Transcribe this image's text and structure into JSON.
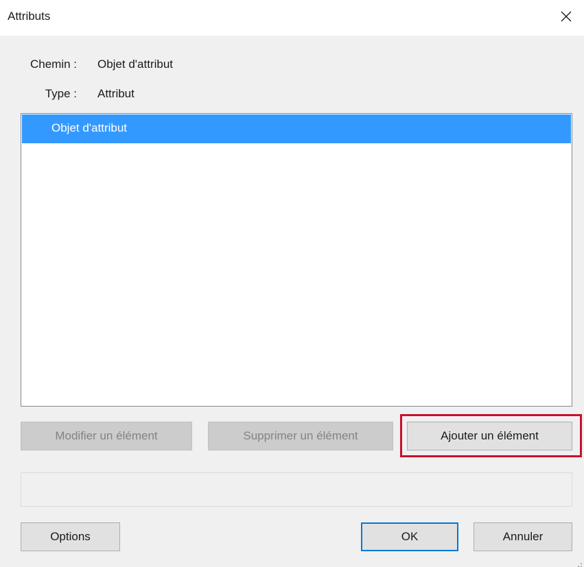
{
  "window": {
    "title": "Attributs",
    "close_icon": "close-icon"
  },
  "fields": {
    "path_label": "Chemin :",
    "path_value": "Objet d'attribut",
    "type_label": "Type :",
    "type_value": "Attribut"
  },
  "list": {
    "items": [
      {
        "label": "Objet d'attribut",
        "selected": true
      }
    ],
    "selection_color": "#3399ff"
  },
  "actions": {
    "modify_label": "Modifier un élément",
    "delete_label": "Supprimer un élément",
    "add_label": "Ajouter un élément"
  },
  "footer": {
    "status_text": "",
    "options_label": "Options",
    "ok_label": "OK",
    "cancel_label": "Annuler"
  },
  "colors": {
    "highlight_border": "#c8102e",
    "default_button_border": "#0078d7"
  }
}
